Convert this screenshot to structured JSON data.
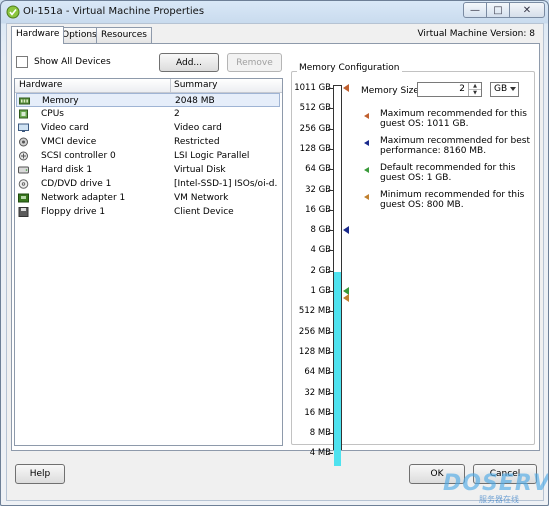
{
  "window": {
    "title": "OI-151a - Virtual Machine Properties"
  },
  "tabs": [
    {
      "label": "Hardware",
      "active": true
    },
    {
      "label": "Options",
      "active": false
    },
    {
      "label": "Resources",
      "active": false
    }
  ],
  "vm_version": "Virtual Machine Version: 8",
  "hardware": {
    "show_all_devices": {
      "label": "Show All Devices",
      "checked": false
    },
    "add_label": "Add...",
    "remove_label": "Remove",
    "columns": [
      "Hardware",
      "Summary"
    ],
    "rows": [
      {
        "icon": "memory-icon",
        "name": "Memory",
        "summary": "2048 MB",
        "selected": true
      },
      {
        "icon": "cpu-icon",
        "name": "CPUs",
        "summary": "2",
        "selected": false
      },
      {
        "icon": "video-card-icon",
        "name": "Video card",
        "summary": "Video card",
        "selected": false
      },
      {
        "icon": "vmci-device-icon",
        "name": "VMCI device",
        "summary": "Restricted",
        "selected": false
      },
      {
        "icon": "scsi-controller-icon",
        "name": "SCSI controller 0",
        "summary": "LSI Logic Parallel",
        "selected": false
      },
      {
        "icon": "hard-disk-icon",
        "name": "Hard disk 1",
        "summary": "Virtual Disk",
        "selected": false
      },
      {
        "icon": "cd-dvd-icon",
        "name": "CD/DVD drive 1",
        "summary": "[Intel-SSD-1] ISOs/oi-d...",
        "selected": false
      },
      {
        "icon": "network-adapter-icon",
        "name": "Network adapter 1",
        "summary": "VM Network",
        "selected": false
      },
      {
        "icon": "floppy-icon",
        "name": "Floppy drive 1",
        "summary": "Client Device",
        "selected": false
      }
    ]
  },
  "memory": {
    "group_title": "Memory Configuration",
    "size_label": "Memory Size:",
    "size_value": "2",
    "unit": "GB",
    "scale_labels": [
      "1011 GB",
      "512 GB",
      "256 GB",
      "128 GB",
      "64 GB",
      "32 GB",
      "16 GB",
      "8 GB",
      "4 GB",
      "2 GB",
      "1 GB",
      "512 MB",
      "256 MB",
      "128 MB",
      "64 MB",
      "32 MB",
      "16 MB",
      "8 MB",
      "4 MB"
    ],
    "current_mb": 2048,
    "legend": [
      {
        "color": "#c06030",
        "text": "Maximum recommended for this guest OS: 1011 GB."
      },
      {
        "color": "#1a2a8c",
        "text": "Maximum recommended for best performance: 8160 MB."
      },
      {
        "color": "#3a9a3a",
        "text": "Default recommended for this guest OS: 1 GB."
      },
      {
        "color": "#c08030",
        "text": "Minimum recommended for this guest OS: 800 MB."
      }
    ]
  },
  "footer": {
    "help_label": "Help",
    "ok_label": "OK",
    "cancel_label": "Cancel"
  },
  "watermark": {
    "text": "DOSERV",
    "subtext": "服务器在线"
  }
}
